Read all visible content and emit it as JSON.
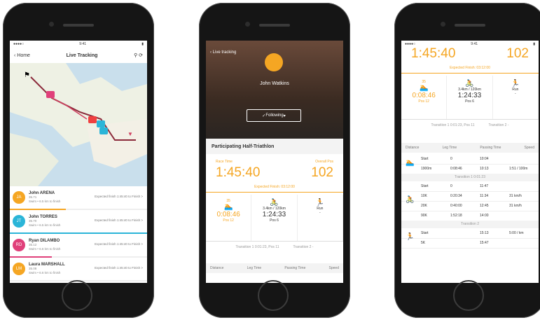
{
  "phone1": {
    "nav": {
      "back": "Home",
      "title": "Live Tracking"
    },
    "map_labels": {
      "start": "⚑"
    },
    "athletes": [
      {
        "initials": "JA",
        "name": "John ARENA",
        "sub1": "35.71",
        "sub2": "Swim • 6.5 km to finish",
        "stat": "Expected finish 1:45:40 to Finish >",
        "color": "#f5a623"
      },
      {
        "initials": "JT",
        "name": "John TORRES",
        "sub1": "35.70",
        "sub2": "Swim • 6.5 km to finish",
        "stat": "Expected finish 1:45:40 to Finish >",
        "color": "#2bb5d8"
      },
      {
        "initials": "RD",
        "name": "Ryan DILAMBO",
        "sub1": "35.12",
        "sub2": "Swim • 6.6 km to finish",
        "stat": "Expected finish 1:45:40 to Finish >",
        "color": "#e0407a"
      },
      {
        "initials": "LM",
        "name": "Laura MARSHALL",
        "sub1": "35.08",
        "sub2": "Swim • 6.6 km to finish",
        "stat": "Expected finish 1:45:40 to Finish >",
        "color": "#f5a623"
      }
    ]
  },
  "phone2": {
    "back": "Live tracking",
    "athlete_name": "John Watkins",
    "follow_button": "Following",
    "section_title": "Participating Half-Triathlon",
    "race_time_label": "Race Time",
    "race_time": "1:45:40",
    "overall_pos_label": "Overall Pos",
    "overall_pos": "102",
    "expected": "Expected Finish: 03:12:00",
    "cells": [
      {
        "icon": "🏊",
        "line1": "0:08:46",
        "line2": "Pos 12",
        "top": "35"
      },
      {
        "icon": "🚴",
        "line1": "3.4km / 120km",
        "value": "1:24:33",
        "line2": "Pos 6"
      },
      {
        "icon": "🏃",
        "line1": "Run",
        "line2": "-"
      }
    ],
    "transitions": [
      "Transition 1\n0:01:23, Pos 11",
      "Transition 2\n-"
    ],
    "table_headers": [
      "Distance",
      "Leg Time",
      "Passing Time",
      "Speed"
    ]
  },
  "phone3": {
    "race_time": "1:45:40",
    "overall_pos": "102",
    "expected": "Expected Finish: 03:12:00",
    "cells": [
      {
        "top": "35",
        "line1": "0:08:46",
        "line2": "Pos 12"
      },
      {
        "line1": "3.4km / 120km",
        "value": "1:24:33",
        "line2": "Pos 6"
      },
      {
        "line1": "Run",
        "line2": "-"
      }
    ],
    "transitions": [
      "Transition 1\n0:01:23, Pos 11",
      "Transition 2\n-"
    ],
    "table_headers": [
      "Distance",
      "Leg Time",
      "Passing Time",
      "Speed"
    ],
    "swim_rows": [
      [
        "Start",
        "0",
        "10:04",
        ""
      ],
      [
        "1900m",
        "0:08:46",
        "10:13",
        "1:51 / 100m"
      ]
    ],
    "group1": "Transition 1  0:01:23",
    "bike_rows": [
      [
        "Start",
        "0",
        "11:47",
        ""
      ],
      [
        "10K",
        "0:20:34",
        "11:34",
        "31 km/h"
      ],
      [
        "20K",
        "0:40:00",
        "12:45",
        "31 km/h"
      ],
      [
        "90K",
        "1:52:18",
        "14:00",
        ""
      ]
    ],
    "group2": "Transition 2",
    "run_rows": [
      [
        "Start",
        "",
        "15:13",
        "5:00 / km"
      ],
      [
        "5K",
        "",
        "15:47",
        ""
      ]
    ]
  }
}
